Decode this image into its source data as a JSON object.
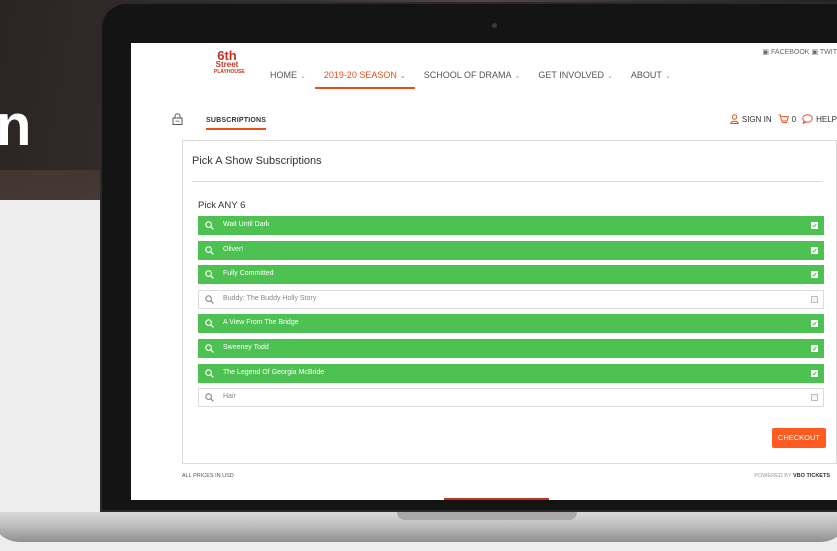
{
  "hero": {
    "letter": "n"
  },
  "header": {
    "logo": {
      "line1": "6th",
      "line2": "Street",
      "line3": "PLAYHOUSE"
    },
    "top_right": "FACEBOOK",
    "top_right_2": "TWIT",
    "nav": [
      {
        "label": "HOME",
        "active": false
      },
      {
        "label": "2019-20 SEASON",
        "active": true
      },
      {
        "label": "SCHOOL OF DRAMA",
        "active": false
      },
      {
        "label": "GET INVOLVED",
        "active": false
      },
      {
        "label": "ABOUT",
        "active": false
      }
    ]
  },
  "subbar": {
    "tab": "SUBSCRIPTIONS",
    "sign_in": "SIGN IN",
    "cart_count": "0",
    "help": "HELP"
  },
  "card": {
    "title": "Pick A Show Subscriptions",
    "group_title": "Pick ANY 6",
    "shows": [
      {
        "name": "Wait Until Dark",
        "selected": true
      },
      {
        "name": "Oliver!",
        "selected": true
      },
      {
        "name": "Fully Committed",
        "selected": true
      },
      {
        "name": "Buddy: The Buddy Holly Story",
        "selected": false
      },
      {
        "name": "A View From The Bridge",
        "selected": true
      },
      {
        "name": "Sweeney Todd",
        "selected": true
      },
      {
        "name": "The Legend Of Georgia McBride",
        "selected": true
      },
      {
        "name": "Hair",
        "selected": false
      }
    ],
    "checkout_label": "CHECKOUT"
  },
  "footer": {
    "left": "ALL PRICES IN USD",
    "right_prefix": "POWERED BY",
    "right_brand": "VBO TICKETS"
  },
  "colors": {
    "accent": "#e8501a",
    "selected_green": "#4dc253",
    "checkout": "#ff5a1f",
    "logo_red": "#c8321e"
  }
}
